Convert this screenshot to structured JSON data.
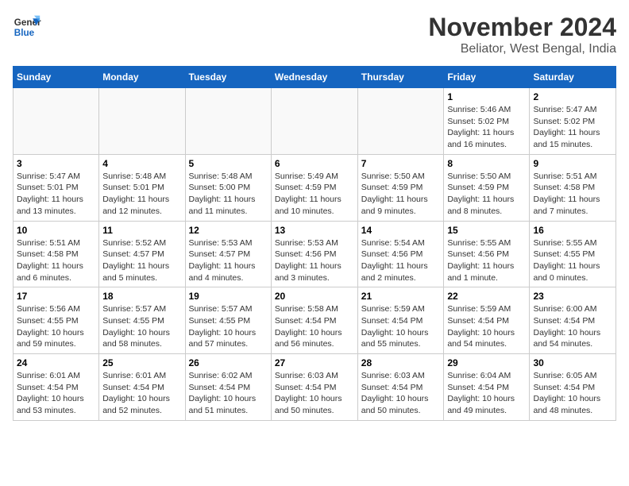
{
  "logo": {
    "line1": "General",
    "line2": "Blue"
  },
  "title": "November 2024",
  "location": "Beliator, West Bengal, India",
  "weekdays": [
    "Sunday",
    "Monday",
    "Tuesday",
    "Wednesday",
    "Thursday",
    "Friday",
    "Saturday"
  ],
  "weeks": [
    [
      {
        "day": "",
        "info": "",
        "empty": true
      },
      {
        "day": "",
        "info": "",
        "empty": true
      },
      {
        "day": "",
        "info": "",
        "empty": true
      },
      {
        "day": "",
        "info": "",
        "empty": true
      },
      {
        "day": "",
        "info": "",
        "empty": true
      },
      {
        "day": "1",
        "info": "Sunrise: 5:46 AM\nSunset: 5:02 PM\nDaylight: 11 hours and 16 minutes."
      },
      {
        "day": "2",
        "info": "Sunrise: 5:47 AM\nSunset: 5:02 PM\nDaylight: 11 hours and 15 minutes."
      }
    ],
    [
      {
        "day": "3",
        "info": "Sunrise: 5:47 AM\nSunset: 5:01 PM\nDaylight: 11 hours and 13 minutes."
      },
      {
        "day": "4",
        "info": "Sunrise: 5:48 AM\nSunset: 5:01 PM\nDaylight: 11 hours and 12 minutes."
      },
      {
        "day": "5",
        "info": "Sunrise: 5:48 AM\nSunset: 5:00 PM\nDaylight: 11 hours and 11 minutes."
      },
      {
        "day": "6",
        "info": "Sunrise: 5:49 AM\nSunset: 4:59 PM\nDaylight: 11 hours and 10 minutes."
      },
      {
        "day": "7",
        "info": "Sunrise: 5:50 AM\nSunset: 4:59 PM\nDaylight: 11 hours and 9 minutes."
      },
      {
        "day": "8",
        "info": "Sunrise: 5:50 AM\nSunset: 4:59 PM\nDaylight: 11 hours and 8 minutes."
      },
      {
        "day": "9",
        "info": "Sunrise: 5:51 AM\nSunset: 4:58 PM\nDaylight: 11 hours and 7 minutes."
      }
    ],
    [
      {
        "day": "10",
        "info": "Sunrise: 5:51 AM\nSunset: 4:58 PM\nDaylight: 11 hours and 6 minutes."
      },
      {
        "day": "11",
        "info": "Sunrise: 5:52 AM\nSunset: 4:57 PM\nDaylight: 11 hours and 5 minutes."
      },
      {
        "day": "12",
        "info": "Sunrise: 5:53 AM\nSunset: 4:57 PM\nDaylight: 11 hours and 4 minutes."
      },
      {
        "day": "13",
        "info": "Sunrise: 5:53 AM\nSunset: 4:56 PM\nDaylight: 11 hours and 3 minutes."
      },
      {
        "day": "14",
        "info": "Sunrise: 5:54 AM\nSunset: 4:56 PM\nDaylight: 11 hours and 2 minutes."
      },
      {
        "day": "15",
        "info": "Sunrise: 5:55 AM\nSunset: 4:56 PM\nDaylight: 11 hours and 1 minute."
      },
      {
        "day": "16",
        "info": "Sunrise: 5:55 AM\nSunset: 4:55 PM\nDaylight: 11 hours and 0 minutes."
      }
    ],
    [
      {
        "day": "17",
        "info": "Sunrise: 5:56 AM\nSunset: 4:55 PM\nDaylight: 10 hours and 59 minutes."
      },
      {
        "day": "18",
        "info": "Sunrise: 5:57 AM\nSunset: 4:55 PM\nDaylight: 10 hours and 58 minutes."
      },
      {
        "day": "19",
        "info": "Sunrise: 5:57 AM\nSunset: 4:55 PM\nDaylight: 10 hours and 57 minutes."
      },
      {
        "day": "20",
        "info": "Sunrise: 5:58 AM\nSunset: 4:54 PM\nDaylight: 10 hours and 56 minutes."
      },
      {
        "day": "21",
        "info": "Sunrise: 5:59 AM\nSunset: 4:54 PM\nDaylight: 10 hours and 55 minutes."
      },
      {
        "day": "22",
        "info": "Sunrise: 5:59 AM\nSunset: 4:54 PM\nDaylight: 10 hours and 54 minutes."
      },
      {
        "day": "23",
        "info": "Sunrise: 6:00 AM\nSunset: 4:54 PM\nDaylight: 10 hours and 54 minutes."
      }
    ],
    [
      {
        "day": "24",
        "info": "Sunrise: 6:01 AM\nSunset: 4:54 PM\nDaylight: 10 hours and 53 minutes."
      },
      {
        "day": "25",
        "info": "Sunrise: 6:01 AM\nSunset: 4:54 PM\nDaylight: 10 hours and 52 minutes."
      },
      {
        "day": "26",
        "info": "Sunrise: 6:02 AM\nSunset: 4:54 PM\nDaylight: 10 hours and 51 minutes."
      },
      {
        "day": "27",
        "info": "Sunrise: 6:03 AM\nSunset: 4:54 PM\nDaylight: 10 hours and 50 minutes."
      },
      {
        "day": "28",
        "info": "Sunrise: 6:03 AM\nSunset: 4:54 PM\nDaylight: 10 hours and 50 minutes."
      },
      {
        "day": "29",
        "info": "Sunrise: 6:04 AM\nSunset: 4:54 PM\nDaylight: 10 hours and 49 minutes."
      },
      {
        "day": "30",
        "info": "Sunrise: 6:05 AM\nSunset: 4:54 PM\nDaylight: 10 hours and 48 minutes."
      }
    ]
  ]
}
